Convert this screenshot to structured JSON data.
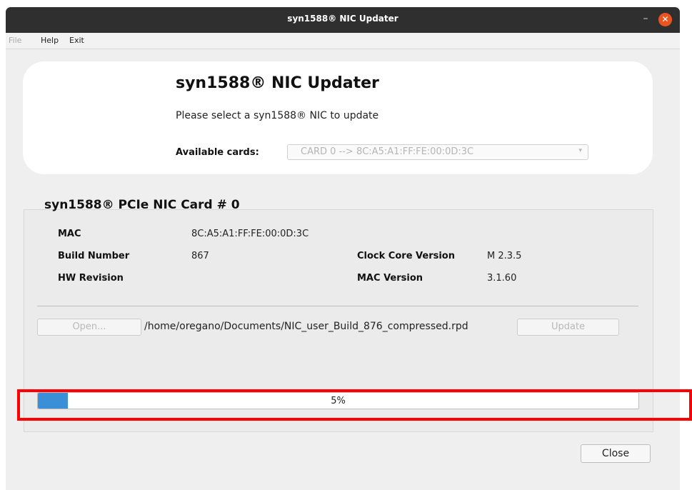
{
  "window": {
    "title": "syn1588® NIC Updater",
    "minimize_glyph": "–",
    "close_glyph": "✕"
  },
  "menu": {
    "file": "File",
    "help": "Help",
    "exit": "Exit"
  },
  "header": {
    "title": "syn1588® NIC Updater",
    "subtitle": "Please select a syn1588® NIC to update",
    "available_label": "Available cards:",
    "selected_card": "CARD 0 --> 8C:A5:A1:FF:FE:00:0D:3C"
  },
  "card_info": {
    "section_title": "syn1588® PCIe NIC Card # 0",
    "mac_label": "MAC",
    "mac_value": "8C:A5:A1:FF:FE:00:0D:3C",
    "build_label": "Build Number",
    "build_value": "867",
    "hw_label": "HW Revision",
    "hw_value": "",
    "clock_label": "Clock Core Version",
    "clock_value": "M 2.3.5",
    "macver_label": "MAC Version",
    "macver_value": "3.1.60"
  },
  "file_row": {
    "open_label": "Open...",
    "path": "/home/oregano/Documents/NIC_user_Build_876_compressed.rpd",
    "update_label": "Update"
  },
  "progress": {
    "text": "5%",
    "value_percent": 5
  },
  "footer": {
    "close_label": "Close"
  },
  "colors": {
    "accent": "#3b8fd6",
    "close_icon": "#e95420",
    "highlight": "#ff0000"
  }
}
